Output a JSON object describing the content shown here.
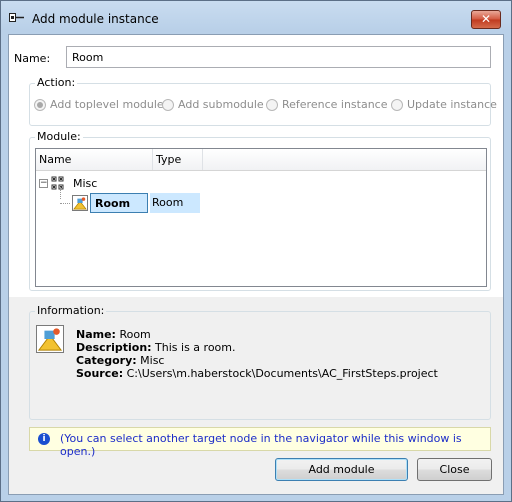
{
  "window": {
    "title": "Add module instance",
    "close_label": "✕"
  },
  "name_field": {
    "label": "Name:",
    "value": "Room"
  },
  "action": {
    "label": "Action:",
    "options": [
      {
        "label": "Add toplevel module",
        "checked": true
      },
      {
        "label": "Add submodule",
        "checked": false
      },
      {
        "label": "Reference instance",
        "checked": false
      },
      {
        "label": "Update instance",
        "checked": false
      }
    ]
  },
  "module": {
    "label": "Module:",
    "columns": [
      "Name",
      "Type"
    ],
    "tree": {
      "folder_label": "Misc",
      "expander": "−",
      "item": {
        "name": "Room",
        "type": "Room"
      }
    }
  },
  "information": {
    "label": "Information:",
    "name_key": "Name:",
    "name_value": "Room",
    "description_key": "Description:",
    "description_value": "This is a room.",
    "category_key": "Category:",
    "category_value": "Misc",
    "source_key": "Source:",
    "source_value": "C:\\Users\\m.haberstock\\Documents\\AC_FirstSteps.project"
  },
  "hint": {
    "icon": "i",
    "text": "(You can select another target node in the navigator while this window is open.)"
  },
  "buttons": {
    "add_module": "Add module",
    "close": "Close"
  },
  "colors": {
    "accent": "#3c7fb1",
    "selection": "#cce8ff",
    "hint_text": "#1c2cc8"
  }
}
